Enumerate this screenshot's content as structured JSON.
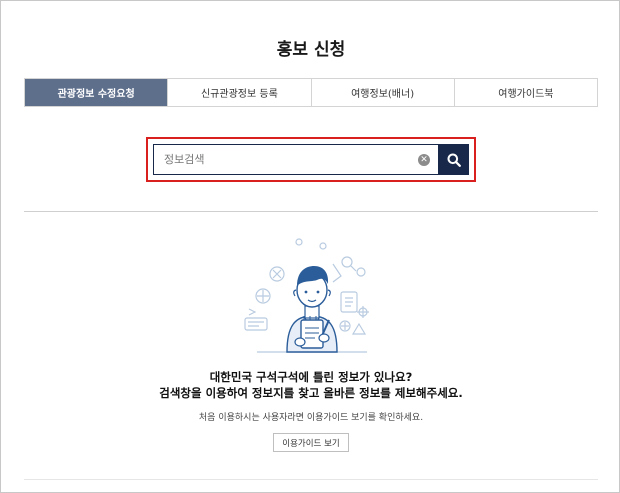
{
  "header": {
    "title": "홍보 신청"
  },
  "tabs": [
    {
      "label": "관광정보 수정요청",
      "active": true
    },
    {
      "label": "신규관광정보 등록",
      "active": false
    },
    {
      "label": "여행정보(배너)",
      "active": false
    },
    {
      "label": "여행가이드북",
      "active": false
    }
  ],
  "search": {
    "placeholder": "정보검색",
    "value": ""
  },
  "icons": {
    "clear": "clear-icon",
    "search": "search-icon",
    "illustration": "person-with-notepad-illustration"
  },
  "colors": {
    "active_tab": "#5e6f8c",
    "search_button": "#17284b",
    "highlight": "#d9201f"
  },
  "empty_state": {
    "title": "대한민국 구석구석에 틀린 정보가 있나요?",
    "body": "검색창을 이용하여 정보지를 찾고 올바른 정보를 제보해주세요.",
    "sub": "처음 이용하시는 사용자라면 이용가이드 보기를 확인하세요.",
    "guide_button": "이용가이드 보기"
  }
}
